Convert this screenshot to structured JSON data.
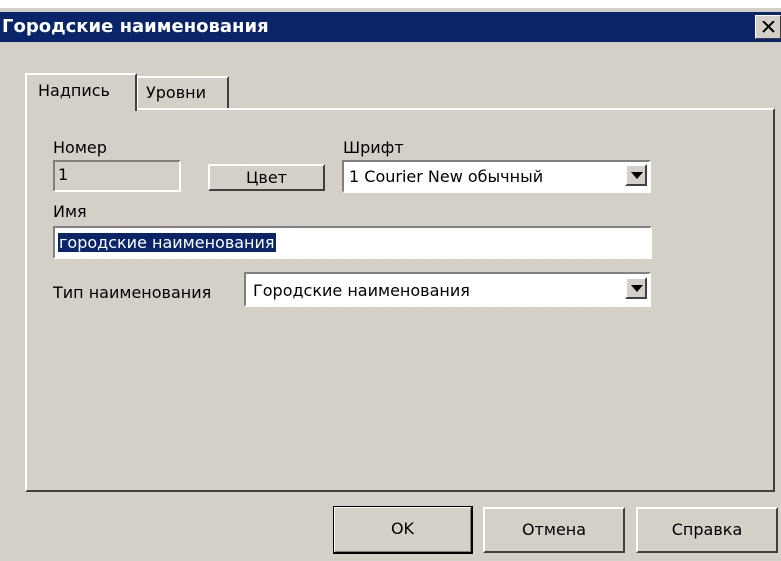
{
  "window": {
    "title": "Городские наименования"
  },
  "tabs": [
    {
      "label": "Надпись",
      "active": true
    },
    {
      "label": "Уровни",
      "active": false
    }
  ],
  "form": {
    "number": {
      "label": "Номер",
      "value": "1"
    },
    "color_button": "Цвет",
    "font": {
      "label": "Шрифт",
      "value": "1 Courier New обычный"
    },
    "name": {
      "label": "Имя",
      "value": "городские наименования"
    },
    "name_type": {
      "label": "Тип наименования",
      "value": "Городские наименования"
    }
  },
  "buttons": {
    "ok": "OK",
    "cancel": "Отмена",
    "help": "Справка"
  },
  "icons": {
    "close": "close-icon",
    "dropdown": "chevron-down-icon"
  },
  "colors": {
    "titlebar": "#0a246a",
    "dialog_face": "#d4d0c8",
    "selection": "#0a246a"
  }
}
